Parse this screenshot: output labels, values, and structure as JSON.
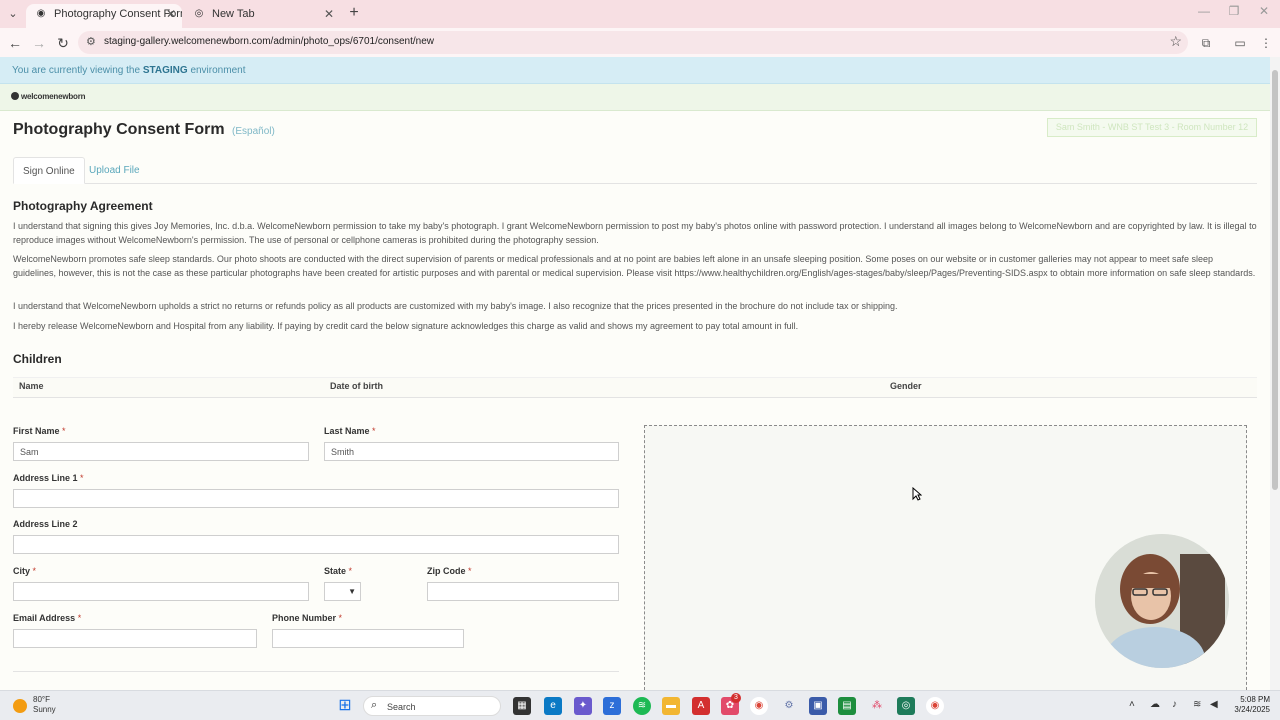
{
  "browser": {
    "tabs": [
      {
        "title": "Photography Consent Form | W",
        "active": true
      },
      {
        "title": "New Tab",
        "active": false
      }
    ],
    "url": "staging-gallery.welcomenewborn.com/admin/photo_ops/6701/consent/new"
  },
  "staging_banner": {
    "prefix": "You are currently viewing the",
    "env": "STAGING",
    "suffix": "environment"
  },
  "logo": {
    "text": "welcomenewborn"
  },
  "page": {
    "title": "Photography Consent Form",
    "language_link": "(Español)",
    "session_badge": "Sam Smith - WNB ST Test 3 - Room Number 12"
  },
  "form_tabs": [
    {
      "label": "Sign Online",
      "active": true
    },
    {
      "label": "Upload File",
      "active": false
    }
  ],
  "agreement": {
    "heading": "Photography Agreement",
    "paragraphs": [
      "I understand that signing this gives Joy Memories, Inc. d.b.a. WelcomeNewborn permission to take my baby's photograph. I grant WelcomeNewborn permission to post my baby's photos online with password protection. I understand all images belong to WelcomeNewborn and are copyrighted by law. It is illegal to reproduce images without WelcomeNewborn's permission. The use of personal or cellphone cameras is prohibited during the photography session.",
      "WelcomeNewborn promotes safe sleep standards. Our photo shoots are conducted with the direct supervision of parents or medical professionals and at no point are babies left alone in an unsafe sleeping position. Some poses on our website or in customer galleries may not appear to meet safe sleep guidelines, however, this is not the case as these particular photographs have been created for artistic purposes and with parental or medical supervision. Please visit https://www.healthychildren.org/English/ages-stages/baby/sleep/Pages/Preventing-SIDS.aspx to obtain more information on safe sleep standards.",
      "I understand that WelcomeNewborn upholds a strict no returns or refunds policy as all products are customized with my baby's image. I also recognize that the prices presented in the brochure do not include tax or shipping.",
      "I hereby release WelcomeNewborn and Hospital from any liability. If paying by credit card the below signature acknowledges this charge as valid and shows my agreement to pay total amount in full."
    ]
  },
  "children": {
    "heading": "Children",
    "columns": [
      "Name",
      "Date of birth",
      "Gender"
    ]
  },
  "form": {
    "first_name": {
      "label": "First Name",
      "value": "Sam"
    },
    "last_name": {
      "label": "Last Name",
      "value": "Smith"
    },
    "address1": {
      "label": "Address Line 1",
      "value": ""
    },
    "address2": {
      "label": "Address Line 2",
      "value": ""
    },
    "city": {
      "label": "City",
      "value": ""
    },
    "state": {
      "label": "State",
      "value": ""
    },
    "zip": {
      "label": "Zip Code",
      "value": ""
    },
    "email": {
      "label": "Email Address",
      "value": ""
    },
    "phone": {
      "label": "Phone Number",
      "value": ""
    },
    "required_mark": "*"
  },
  "taskbar": {
    "weather_temp": "80°F",
    "weather_desc": "Sunny",
    "search_label": "Search",
    "time": "5:08 PM",
    "date": "3/24/2025",
    "badge_count": "3"
  },
  "colors": {
    "staging_bg": "#d6edf5",
    "logo_bar_bg": "#eef6e8",
    "link": "#5aa7bb",
    "required": "#c0392b"
  }
}
